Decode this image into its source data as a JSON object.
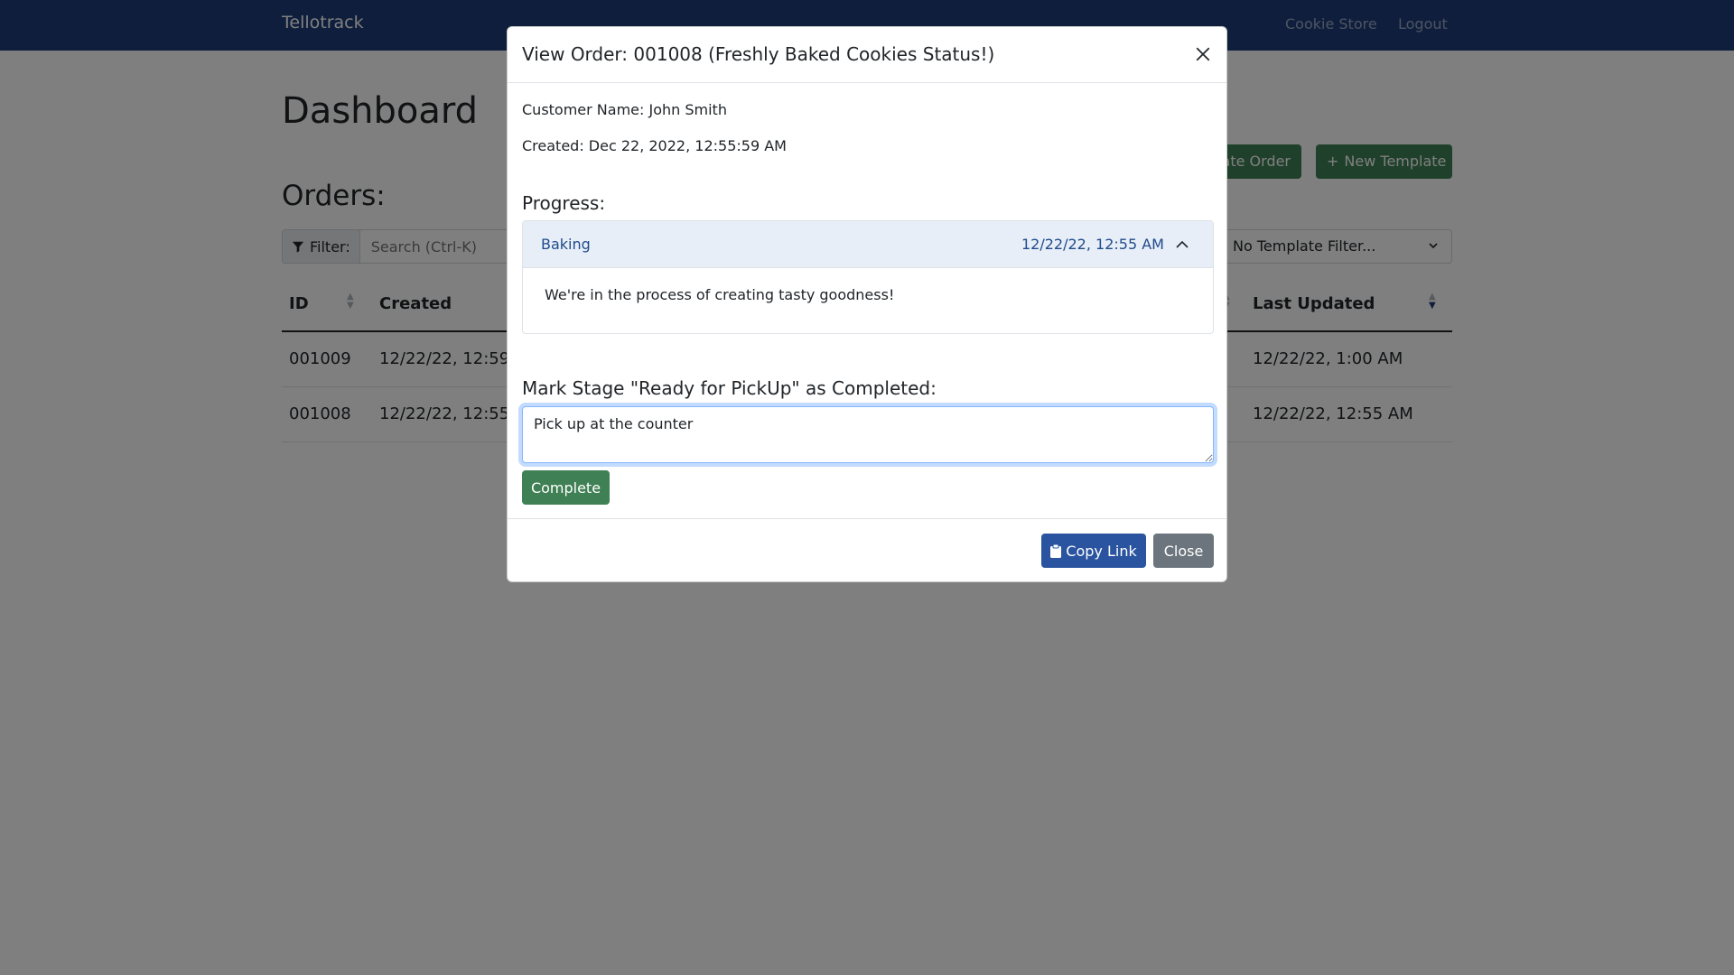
{
  "navbar": {
    "brand": "Tellotrack",
    "links": [
      "Cookie Store",
      "Logout"
    ]
  },
  "page": {
    "title": "Dashboard",
    "orders_heading": "Orders:",
    "create_order_label": "ate Order",
    "new_template_label": "New Template",
    "filter_label": "Filter:",
    "search_placeholder": "Search (Ctrl-K)",
    "template_filter_value": "No Template Filter..."
  },
  "table": {
    "columns": [
      "ID",
      "Created",
      "Last Updated"
    ],
    "rows": [
      {
        "id": "001009",
        "created": "12/22/22, 12:59 A",
        "updated": "12/22/22, 1:00 AM"
      },
      {
        "id": "001008",
        "created": "12/22/22, 12:55 A",
        "updated": "12/22/22, 12:55 AM"
      }
    ]
  },
  "modal": {
    "title": "View Order: 001008 (Freshly Baked Cookies Status!)",
    "customer_line": "Customer Name: John Smith",
    "created_line": "Created: Dec 22, 2022, 12:55:59 AM",
    "progress_heading": "Progress:",
    "stage": {
      "name": "Baking",
      "timestamp": "12/22/22, 12:55 AM",
      "message": "We're in the process of creating tasty goodness!"
    },
    "mark_stage_label": "Mark Stage \"Ready for PickUp\" as Completed:",
    "textarea_value": "Pick up at the counter",
    "complete_label": "Complete",
    "copy_link_label": "Copy Link",
    "close_label": "Close"
  },
  "colors": {
    "navbar": "#1f3d7a",
    "success": "#3f8054",
    "primary": "#2a54a0",
    "secondary": "#6c757d",
    "accordion_active_bg": "#e7eef8"
  },
  "icons": {
    "filter": "funnel-icon",
    "sort": "sort-icon",
    "chevron_up": "chevron-up-icon",
    "chevron_down": "chevron-down-icon",
    "close": "close-icon",
    "clipboard": "clipboard-icon",
    "plus": "plus-icon"
  }
}
